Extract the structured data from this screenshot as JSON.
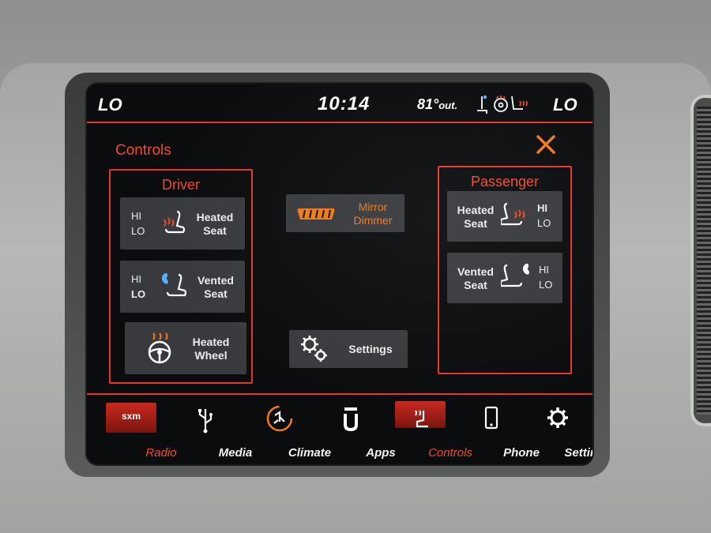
{
  "status_bar": {
    "left_temp": "LO",
    "time": "10:14",
    "outside_temp": "81°",
    "outside_label": "out.",
    "right_temp": "LO",
    "icons": [
      "vented-seat-icon",
      "steering-wheel-heat-icon",
      "heated-seat-icon"
    ]
  },
  "page": {
    "title": "Controls",
    "close_icon": "close-x-icon"
  },
  "driver": {
    "title": "Driver",
    "heated_seat": {
      "hi": "HI",
      "lo": "LO",
      "label_line1": "Heated",
      "label_line2": "Seat"
    },
    "vented_seat": {
      "hi": "HI",
      "lo": "LO",
      "label_line1": "Vented",
      "label_line2": "Seat"
    },
    "heated_wheel": {
      "label_line1": "Heated",
      "label_line2": "Wheel"
    }
  },
  "center": {
    "mirror_dimmer": {
      "label_line1": "Mirror",
      "label_line2": "Dimmer"
    },
    "settings": {
      "label": "Settings"
    }
  },
  "passenger": {
    "title": "Passenger",
    "heated_seat": {
      "hi": "HI",
      "lo": "LO",
      "label_line1": "Heated",
      "label_line2": "Seat"
    },
    "vented_seat": {
      "hi": "HI",
      "lo": "LO",
      "label_line1": "Vented",
      "label_line2": "Seat"
    }
  },
  "nav": [
    {
      "label": "Radio",
      "icon": "sxm-icon",
      "icon_text": "sxm",
      "active": true
    },
    {
      "label": "Media",
      "icon": "usb-icon",
      "active": false
    },
    {
      "label": "Climate",
      "icon": "climate-icon",
      "active": false
    },
    {
      "label": "Apps",
      "icon": "apps-icon",
      "active": false
    },
    {
      "label": "Controls",
      "icon": "controls-icon",
      "active": true
    },
    {
      "label": "Phone",
      "icon": "phone-icon",
      "active": false
    },
    {
      "label": "Settings",
      "icon": "gear-icon",
      "active": false
    }
  ],
  "colors": {
    "accent": "#e6362a",
    "accent_text": "#f04a2a",
    "button_bg": "#383a3d",
    "screen_bg": "#0b0c0e"
  }
}
